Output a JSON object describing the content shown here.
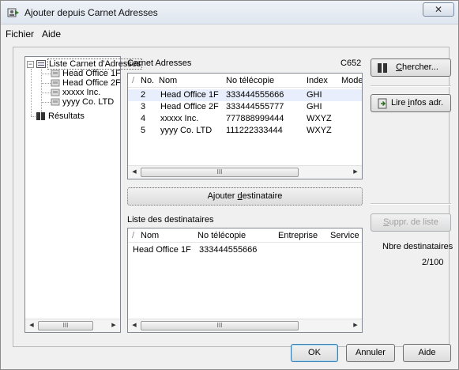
{
  "window": {
    "title": "Ajouter depuis Carnet Adresses",
    "close_symbol": "✕"
  },
  "menu": {
    "items": [
      "Fichier",
      "Aide"
    ]
  },
  "tree": {
    "root_label": "Liste Carnet d'Adresses",
    "children": [
      "Head Office 1F",
      "Head Office 2F",
      "xxxxx Inc.",
      "yyyy Co. LTD"
    ],
    "results_label": "Résultats",
    "scroll_thumb": "III"
  },
  "address_book": {
    "label": "Carnet Adresses",
    "model": "C652",
    "columns": [
      "/",
      "No.",
      "Nom",
      "No télécopie",
      "Index",
      "Mode."
    ],
    "rows": [
      {
        "no": "2",
        "nom": "Head Office 1F",
        "fax": "333444555666",
        "index": "GHI",
        "selected": true
      },
      {
        "no": "3",
        "nom": "Head Office 2F",
        "fax": "333444555777",
        "index": "GHI",
        "selected": false
      },
      {
        "no": "4",
        "nom": "xxxxx Inc.",
        "fax": "777888999444",
        "index": "WXYZ",
        "selected": false
      },
      {
        "no": "5",
        "nom": "yyyy Co. LTD",
        "fax": "111222333444",
        "index": "WXYZ",
        "selected": false
      }
    ],
    "scroll_thumb": "III"
  },
  "buttons": {
    "search": {
      "prefix": "",
      "mnemonic": "C",
      "rest": "hercher..."
    },
    "read_info": {
      "prefix": "Lire ",
      "mnemonic": "i",
      "rest": "nfos adr."
    },
    "add_recipient": {
      "prefix": "Ajouter ",
      "mnemonic": "d",
      "rest": "estinataire"
    },
    "delete_list": {
      "prefix": "",
      "mnemonic": "S",
      "rest": "uppr. de liste"
    },
    "ok": "OK",
    "cancel": "Annuler",
    "help": "Aide"
  },
  "recipients": {
    "label": "Liste des destinataires",
    "columns": [
      "/",
      "Nom",
      "No télécopie",
      "Entreprise",
      "Service"
    ],
    "rows": [
      {
        "nom": "Head Office 1F",
        "fax": "333444555666",
        "company": "",
        "service": ""
      }
    ],
    "count_label": "Nbre destinataires",
    "count_value": "2/100",
    "scroll_thumb": "III"
  },
  "colors": {
    "selection": "#e8eefb",
    "border": "#828790",
    "titlebar": "#dfe6ef"
  },
  "icons": [
    "address-book-icon",
    "phone-book-icon",
    "search-book-icon",
    "read-info-icon",
    "close-icon"
  ]
}
